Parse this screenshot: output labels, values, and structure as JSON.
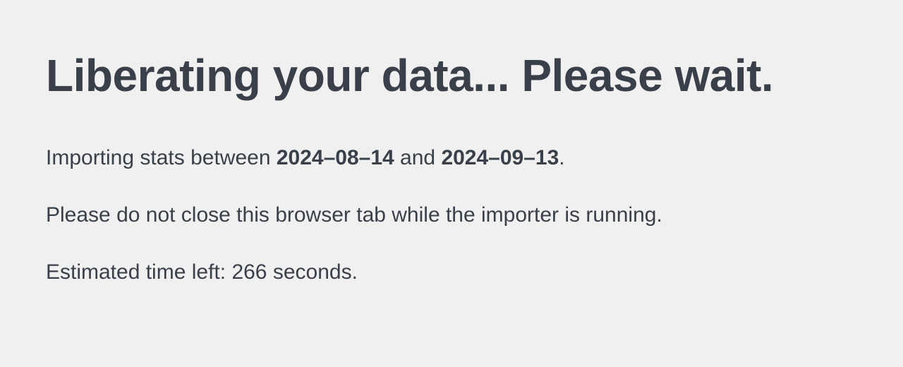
{
  "heading": "Liberating your data... Please wait.",
  "import_line": {
    "prefix": "Importing stats between ",
    "start_date": "2024–08–14",
    "middle": " and ",
    "end_date": "2024–09–13",
    "suffix": "."
  },
  "warning": "Please do not close this browser tab while the importer is running.",
  "eta": {
    "prefix": "Estimated time left: ",
    "seconds": "266",
    "suffix": " seconds."
  }
}
